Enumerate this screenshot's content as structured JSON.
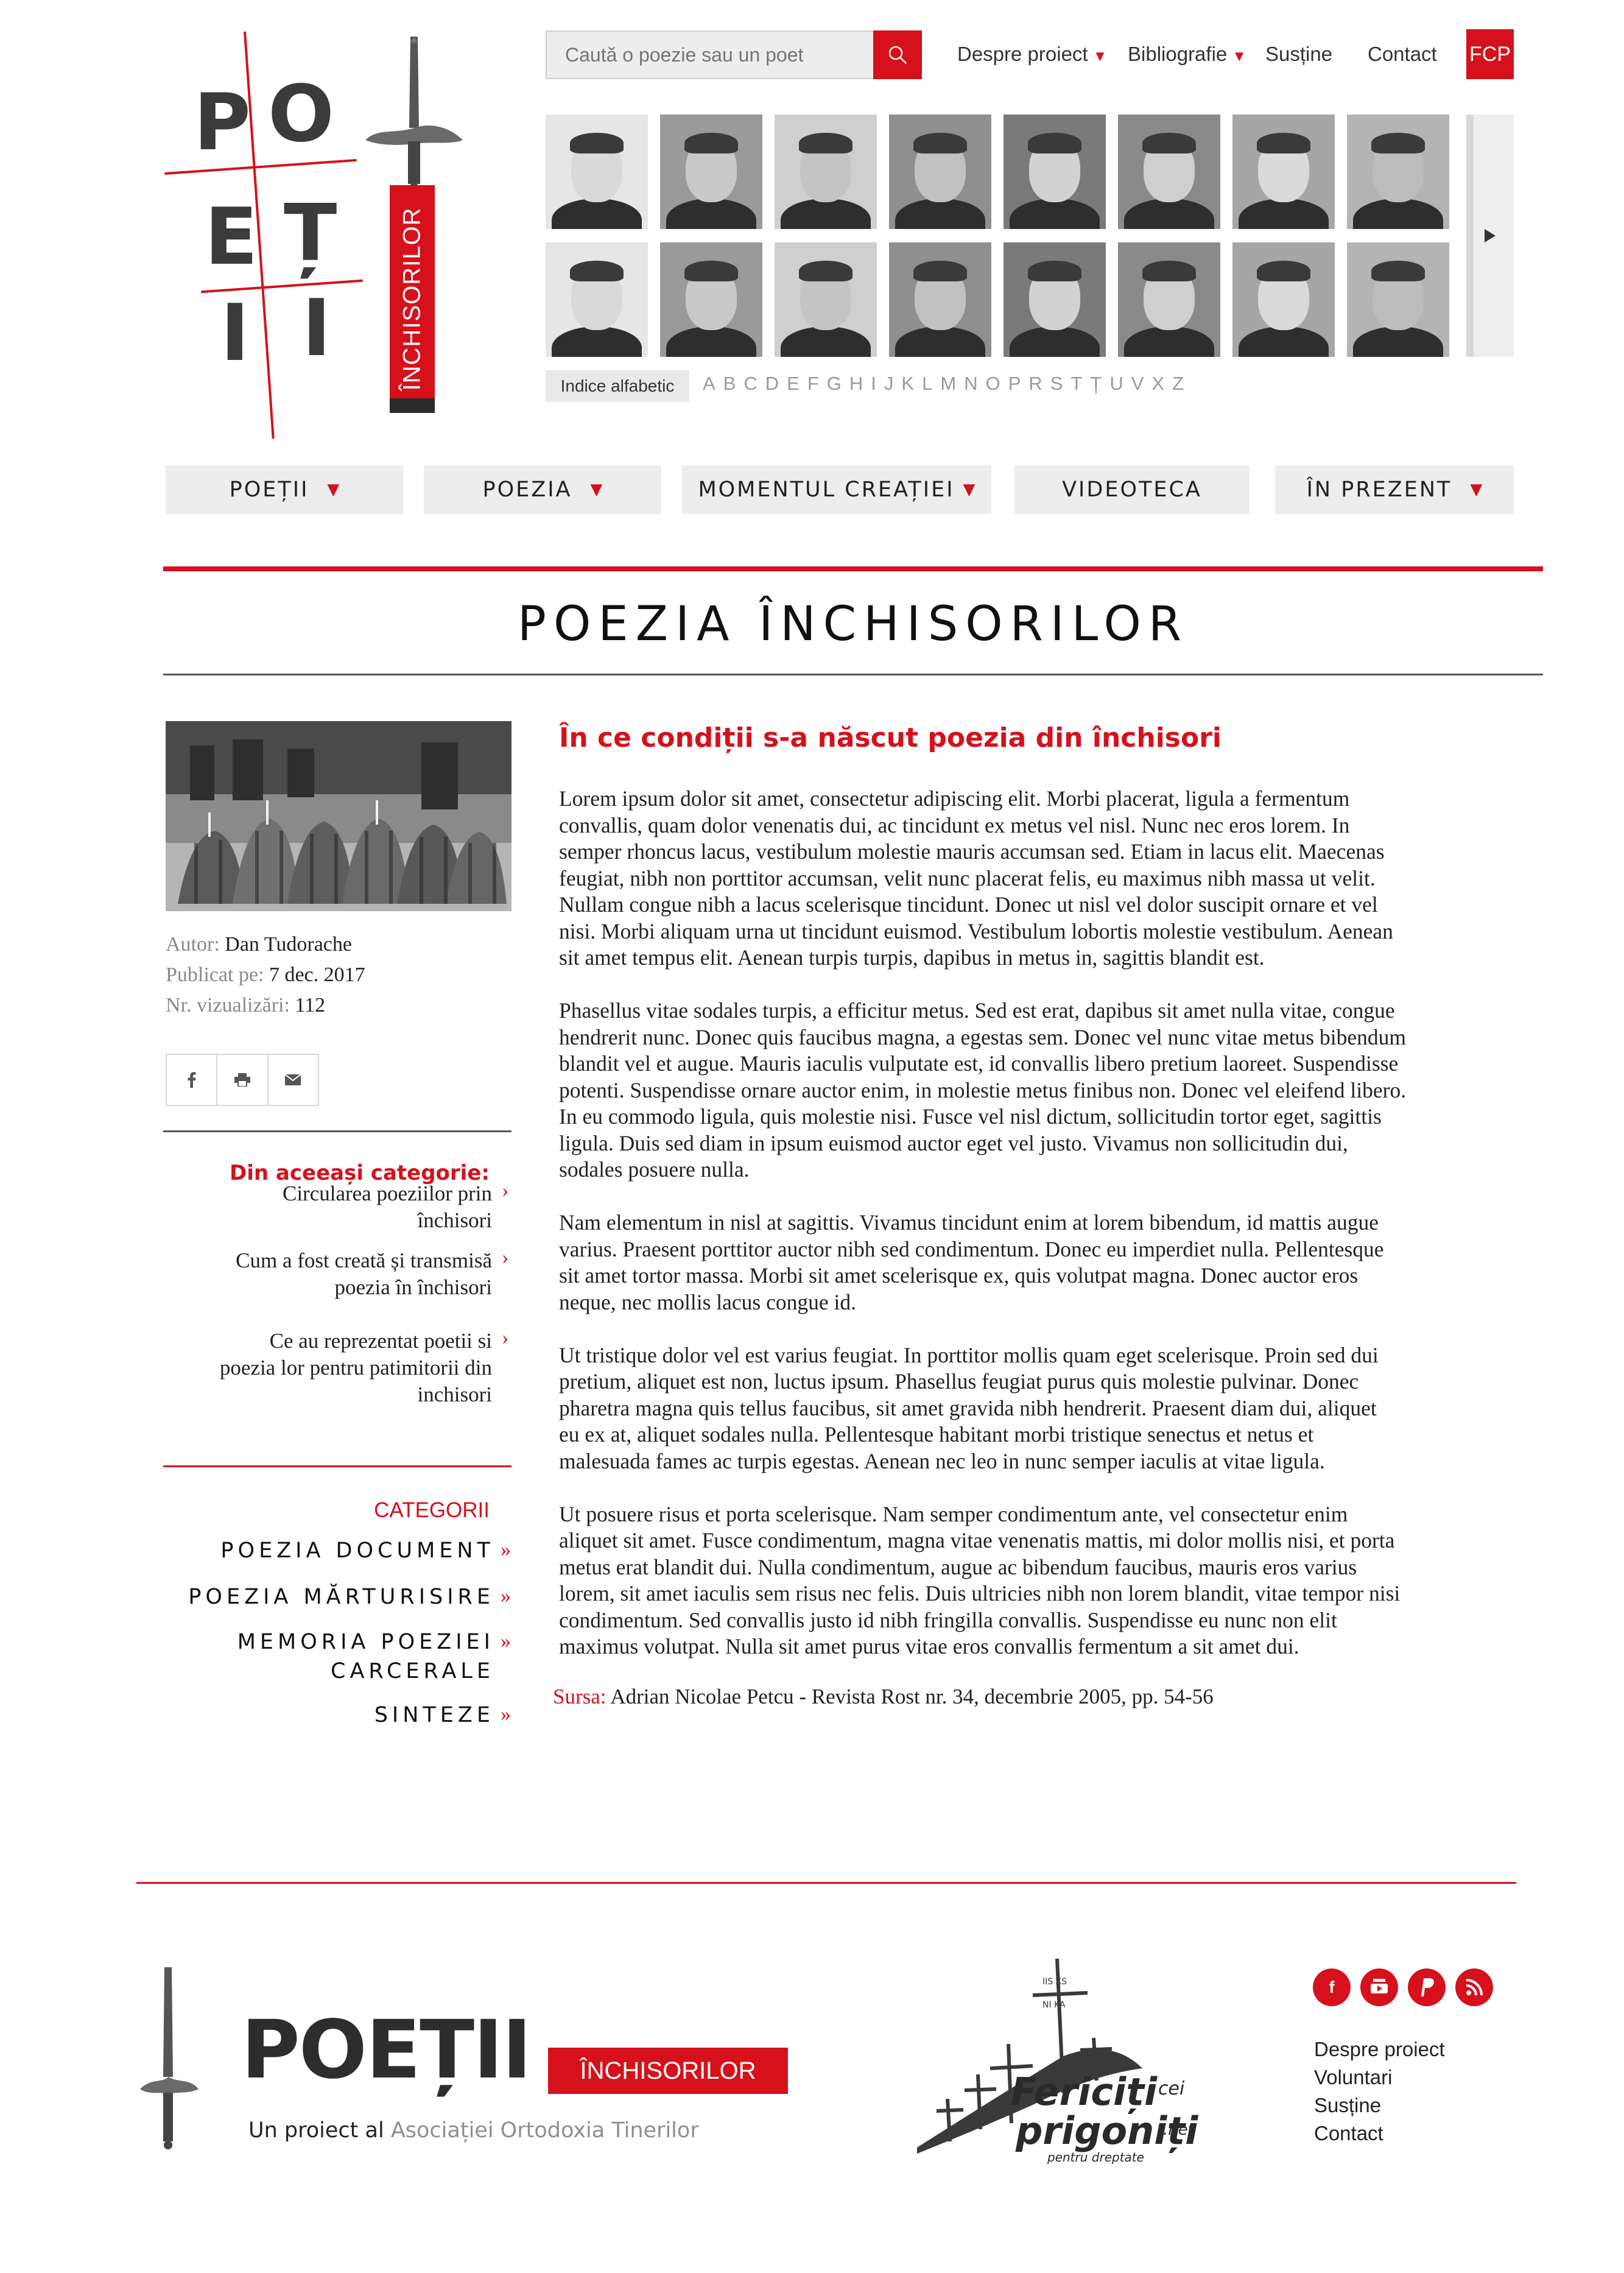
{
  "logo": {
    "letters": [
      "P",
      "O",
      "E",
      "Ț",
      "I",
      "I"
    ],
    "ribbon_text": "ÎNCHISORILOR"
  },
  "search": {
    "placeholder": "Caută o poezie sau un poet"
  },
  "top_nav": [
    {
      "label": "Despre proiect",
      "has_dropdown": true
    },
    {
      "label": "Bibliografie",
      "has_dropdown": true
    },
    {
      "label": "Susține",
      "has_dropdown": false
    },
    {
      "label": "Contact",
      "has_dropdown": false
    }
  ],
  "fcp_label": "FCP",
  "portraits_count": 16,
  "alphabet": {
    "label": "Indice alfabetic",
    "letters": [
      "A",
      "B",
      "C",
      "D",
      "E",
      "F",
      "G",
      "H",
      "I",
      "J",
      "K",
      "L",
      "M",
      "N",
      "O",
      "P",
      "R",
      "S",
      "T",
      "Ț",
      "U",
      "V",
      "X",
      "Z"
    ]
  },
  "main_nav": [
    {
      "label": "POEȚII",
      "has_dropdown": true
    },
    {
      "label": "POEZIA",
      "has_dropdown": true
    },
    {
      "label": "MOMENTUL CREAȚIEI",
      "has_dropdown": true
    },
    {
      "label": "VIDEOTECA",
      "has_dropdown": false
    },
    {
      "label": "ÎN PREZENT",
      "has_dropdown": true
    }
  ],
  "page_title": "POEZIA ÎNCHISORILOR",
  "meta": {
    "author_label": "Autor:",
    "author": "Dan Tudorache",
    "published_label": "Publicat pe:",
    "published": "7 dec. 2017",
    "views_label": "Nr. vizualizări:",
    "views": "112"
  },
  "share_icons": [
    "facebook-icon",
    "print-icon",
    "email-icon"
  ],
  "related": {
    "heading": "Din aceeași categorie:",
    "items": [
      {
        "lines": [
          "Circularea poeziilor prin",
          "închisori"
        ]
      },
      {
        "lines": [
          "Cum a fost creată și transmisă",
          "poezia în închisori"
        ]
      },
      {
        "lines": [
          "Ce au reprezentat poetii si",
          "poezia lor pentru patimitorii din",
          "inchisori"
        ]
      }
    ]
  },
  "categories": {
    "heading": "CATEGORII",
    "items": [
      {
        "lines": [
          "POEZIA DOCUMENT"
        ]
      },
      {
        "lines": [
          "POEZIA MĂRTURISIRE"
        ]
      },
      {
        "lines": [
          "MEMORIA POEZIEI",
          "CARCERALE"
        ]
      },
      {
        "lines": [
          "SINTEZE"
        ]
      }
    ]
  },
  "article": {
    "heading": "În ce condiții s-a născut poezia din închisori",
    "paragraphs": [
      [
        "Lorem ipsum dolor sit amet, consectetur adipiscing elit. Morbi placerat, ligula a fermentum",
        "convallis, quam dolor venenatis dui, ac tincidunt ex metus vel nisl. Nunc nec eros lorem. In",
        "semper rhoncus lacus, vestibulum molestie mauris accumsan sed. Etiam in lacus elit. Maecenas",
        "feugiat, nibh non porttitor accumsan, velit nunc placerat felis, eu maximus nibh massa ut velit.",
        "Nullam congue nibh a lacus scelerisque tincidunt. Donec ut nisl vel dolor suscipit ornare et vel",
        "nisi. Morbi aliquam urna ut tincidunt euismod. Vestibulum lobortis molestie vestibulum. Aenean",
        "sit amet tempus elit. Aenean turpis turpis, dapibus in metus in, sagittis blandit est."
      ],
      [
        "Phasellus vitae sodales turpis, a efficitur metus. Sed est erat, dapibus sit amet nulla vitae, congue",
        "hendrerit nunc. Donec quis faucibus magna, a egestas sem. Donec vel nunc vitae metus bibendum",
        "blandit vel et augue. Mauris iaculis vulputate est, id convallis libero pretium laoreet. Suspendisse",
        "potenti. Suspendisse ornare auctor enim, in molestie metus finibus non. Donec vel eleifend libero.",
        "In eu commodo ligula, quis molestie nisi. Fusce vel nisl dictum, sollicitudin tortor eget, sagittis",
        "ligula. Duis sed diam in ipsum euismod auctor eget vel justo. Vivamus non sollicitudin dui,",
        "sodales posuere nulla."
      ],
      [
        "Nam elementum in nisl at sagittis. Vivamus tincidunt enim at lorem bibendum, id mattis augue",
        "varius. Praesent porttitor auctor nibh sed condimentum. Donec eu imperdiet nulla. Pellentesque",
        "sit amet tortor massa. Morbi sit amet scelerisque ex, quis volutpat magna. Donec auctor eros",
        "neque, nec mollis lacus congue id."
      ],
      [
        "Ut tristique dolor vel est varius feugiat. In porttitor mollis quam eget scelerisque. Proin sed dui",
        "pretium, aliquet est non, luctus ipsum. Phasellus feugiat purus quis molestie pulvinar. Donec",
        "pharetra magna quis tellus faucibus, sit amet gravida nibh hendrerit. Praesent diam dui, aliquet",
        "eu ex at, aliquet sodales nulla. Pellentesque habitant morbi tristique senectus et netus et",
        "malesuada fames ac turpis egestas. Aenean nec leo in nunc semper iaculis at vitae ligula."
      ],
      [
        "Ut posuere risus et porta scelerisque. Nam semper condimentum ante, vel consectetur enim",
        "aliquet sit amet. Fusce condimentum, magna vitae venenatis mattis, mi dolor mollis nisi, et porta",
        "metus erat blandit dui. Nulla condimentum, augue ac bibendum faucibus, mauris eros varius",
        "lorem, sit amet iaculis sem risus nec felis. Duis ultricies nibh non lorem blandit, vitae tempor nisi",
        "condimentum. Sed convallis justo id nibh fringilla convallis. Suspendisse eu nunc non elit",
        "maximus volutpat. Nulla sit amet purus vitae eros convallis fermentum a sit amet dui."
      ]
    ],
    "source_label": "Sursa:",
    "source_text": "Adrian Nicolae Petcu - Revista Rost nr. 34, decembrie 2005, pp. 54-56"
  },
  "footer": {
    "logo_text": "POEȚII",
    "logo_ribbon": "ÎNCHISORILOR",
    "project_prefix": "Un proiect al",
    "project_org": "Asociației Ortodoxia Tinerilor",
    "partner_line1": "Fericiți",
    "partner_cei": "cei",
    "partner_line2": "prigoniți",
    "partner_net": ".net",
    "partner_tagline": "pentru dreptate",
    "social_icons": [
      "facebook-icon",
      "youtube-icon",
      "paypal-icon",
      "rss-icon"
    ],
    "links": [
      "Despre proiect",
      "Voluntari",
      "Susține",
      "Contact"
    ]
  },
  "colors": {
    "accent": "#d6111b",
    "nav_bg": "#ededed",
    "muted_text": "#8a8a8a"
  }
}
